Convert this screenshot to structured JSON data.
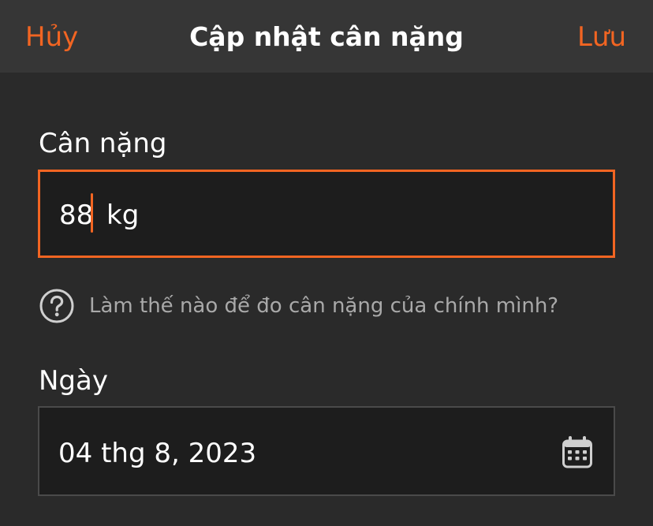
{
  "header": {
    "cancel_label": "Hủy",
    "title": "Cập nhật cân nặng",
    "save_label": "Lưu"
  },
  "weight": {
    "label": "Cân nặng",
    "value": "88",
    "unit": "kg"
  },
  "help": {
    "icon": "question-circle-icon",
    "text": "Làm thế nào để đo cân nặng của chính mình?"
  },
  "date": {
    "label": "Ngày",
    "value": "04 thg 8, 2023",
    "icon": "calendar-icon"
  },
  "colors": {
    "accent": "#f26522",
    "background": "#2a2a2a",
    "header": "#363636",
    "field": "#1d1d1d",
    "muted_text": "#a9a9a9"
  }
}
